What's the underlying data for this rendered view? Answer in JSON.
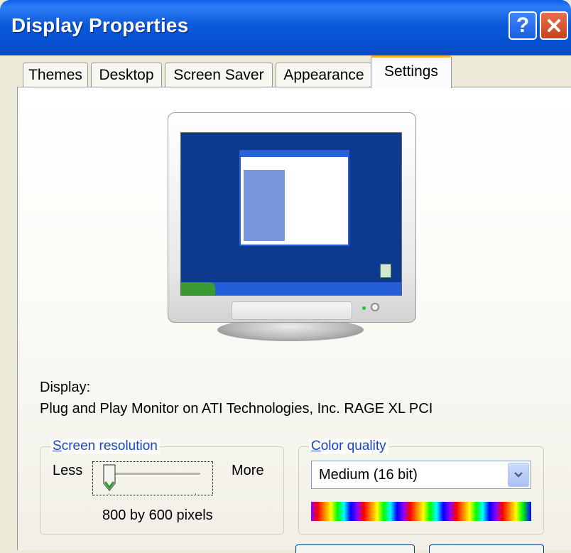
{
  "window": {
    "title": "Display Properties",
    "help_label": "?"
  },
  "tabs": [
    {
      "label": "Themes"
    },
    {
      "label": "Desktop"
    },
    {
      "label": "Screen Saver"
    },
    {
      "label": "Appearance"
    },
    {
      "label": "Settings",
      "active": true
    }
  ],
  "display": {
    "heading": "Display:",
    "device": "Plug and Play Monitor on ATI Technologies, Inc. RAGE XL PCI"
  },
  "resolution": {
    "legend_accel": "S",
    "legend_rest": "creen resolution",
    "less_label": "Less",
    "more_label": "More",
    "value_text": "800 by 600 pixels",
    "slider_position": 0.0
  },
  "color_quality": {
    "legend_accel": "C",
    "legend_rest": "olor quality",
    "selected": "Medium (16 bit)"
  },
  "colors": {
    "titlebar": "#0a5fe8",
    "active_tab_accent": "#f7b334",
    "legend_text": "#1a46c8",
    "desktop_preview": "#0b3a8f"
  }
}
